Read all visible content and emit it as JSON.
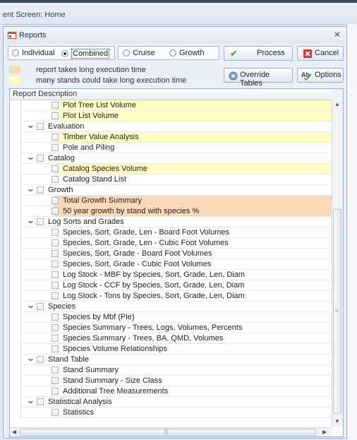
{
  "app": {
    "breadcrumb": "ent Screen: Home"
  },
  "dialog": {
    "title": "Reports",
    "close_glyph": "✕",
    "report_type_options": [
      {
        "label": "Individual",
        "checked": false
      },
      {
        "label": "Combined",
        "checked": true
      }
    ],
    "method_options": [
      {
        "label": "Cruise",
        "checked": false
      },
      {
        "label": "Growth",
        "checked": false
      }
    ],
    "process_label": "Process",
    "cancel_label": "Cancel",
    "override_tables_label": "Override Tables",
    "options_label": "Options",
    "legend": [
      {
        "text": "report takes long execution time",
        "color": "#fbd8b8"
      },
      {
        "text": "many stands could take long execution time",
        "color": "#ffffc4"
      }
    ]
  },
  "grid": {
    "header": "Report Description",
    "rows": [
      {
        "text": "Plot Tree List Volume",
        "group": false,
        "highlight": "yellow"
      },
      {
        "text": "Plot List Volume",
        "group": false,
        "highlight": "yellow"
      },
      {
        "text": "Evaluation",
        "group": true,
        "highlight": "none"
      },
      {
        "text": "Timber Value Analysis",
        "group": false,
        "highlight": "yellow"
      },
      {
        "text": "Pole and Piling",
        "group": false,
        "highlight": "none"
      },
      {
        "text": "Catalog",
        "group": true,
        "highlight": "none"
      },
      {
        "text": "Catalog Species Volume",
        "group": false,
        "highlight": "yellow"
      },
      {
        "text": "Catalog Stand List",
        "group": false,
        "highlight": "none"
      },
      {
        "text": "Growth",
        "group": true,
        "highlight": "none"
      },
      {
        "text": "Total Growth Summary",
        "group": false,
        "highlight": "orange"
      },
      {
        "text": "50 year growth by stand with species %",
        "group": false,
        "highlight": "orange"
      },
      {
        "text": "Log Sorts and Grades",
        "group": true,
        "highlight": "none"
      },
      {
        "text": "Species, Sort, Grade, Len - Board Foot Volumes",
        "group": false,
        "highlight": "none"
      },
      {
        "text": "Species, Sort, Grade, Len - Cubic Foot Volumes",
        "group": false,
        "highlight": "none"
      },
      {
        "text": "Species, Sort, Grade - Board Foot Volumes",
        "group": false,
        "highlight": "none"
      },
      {
        "text": "Species, Sort, Grade - Cubic Foot Volumes",
        "group": false,
        "highlight": "none"
      },
      {
        "text": "Log Stock - MBF by Species, Sort, Grade, Len, Diam",
        "group": false,
        "highlight": "none"
      },
      {
        "text": "Log Stock - CCF by Species, Sort, Grade, Len, Diam",
        "group": false,
        "highlight": "none"
      },
      {
        "text": "Log Stock - Tons by Species, Sort, Grade, Len, Diam",
        "group": false,
        "highlight": "none"
      },
      {
        "text": "Species",
        "group": true,
        "highlight": "none"
      },
      {
        "text": "Species by Mbf (Pie)",
        "group": false,
        "highlight": "none"
      },
      {
        "text": "Species Summary - Trees, Logs, Volumes, Percents",
        "group": false,
        "highlight": "none"
      },
      {
        "text": "Species Summary - Trees, BA, QMD, Volumes",
        "group": false,
        "highlight": "none"
      },
      {
        "text": "Species Volume Relationships",
        "group": false,
        "highlight": "none"
      },
      {
        "text": "Stand Table",
        "group": true,
        "highlight": "none"
      },
      {
        "text": "Stand Summary",
        "group": false,
        "highlight": "none"
      },
      {
        "text": "Stand Summary - Size Class",
        "group": false,
        "highlight": "none"
      },
      {
        "text": "Additional Tree Measurements",
        "group": false,
        "highlight": "none"
      },
      {
        "text": "Statistical Analysis",
        "group": true,
        "highlight": "none"
      },
      {
        "text": "Statistics",
        "group": false,
        "highlight": "none"
      }
    ]
  },
  "colors": {
    "yellow": "#ffffc4",
    "orange": "#fbd8b8"
  }
}
